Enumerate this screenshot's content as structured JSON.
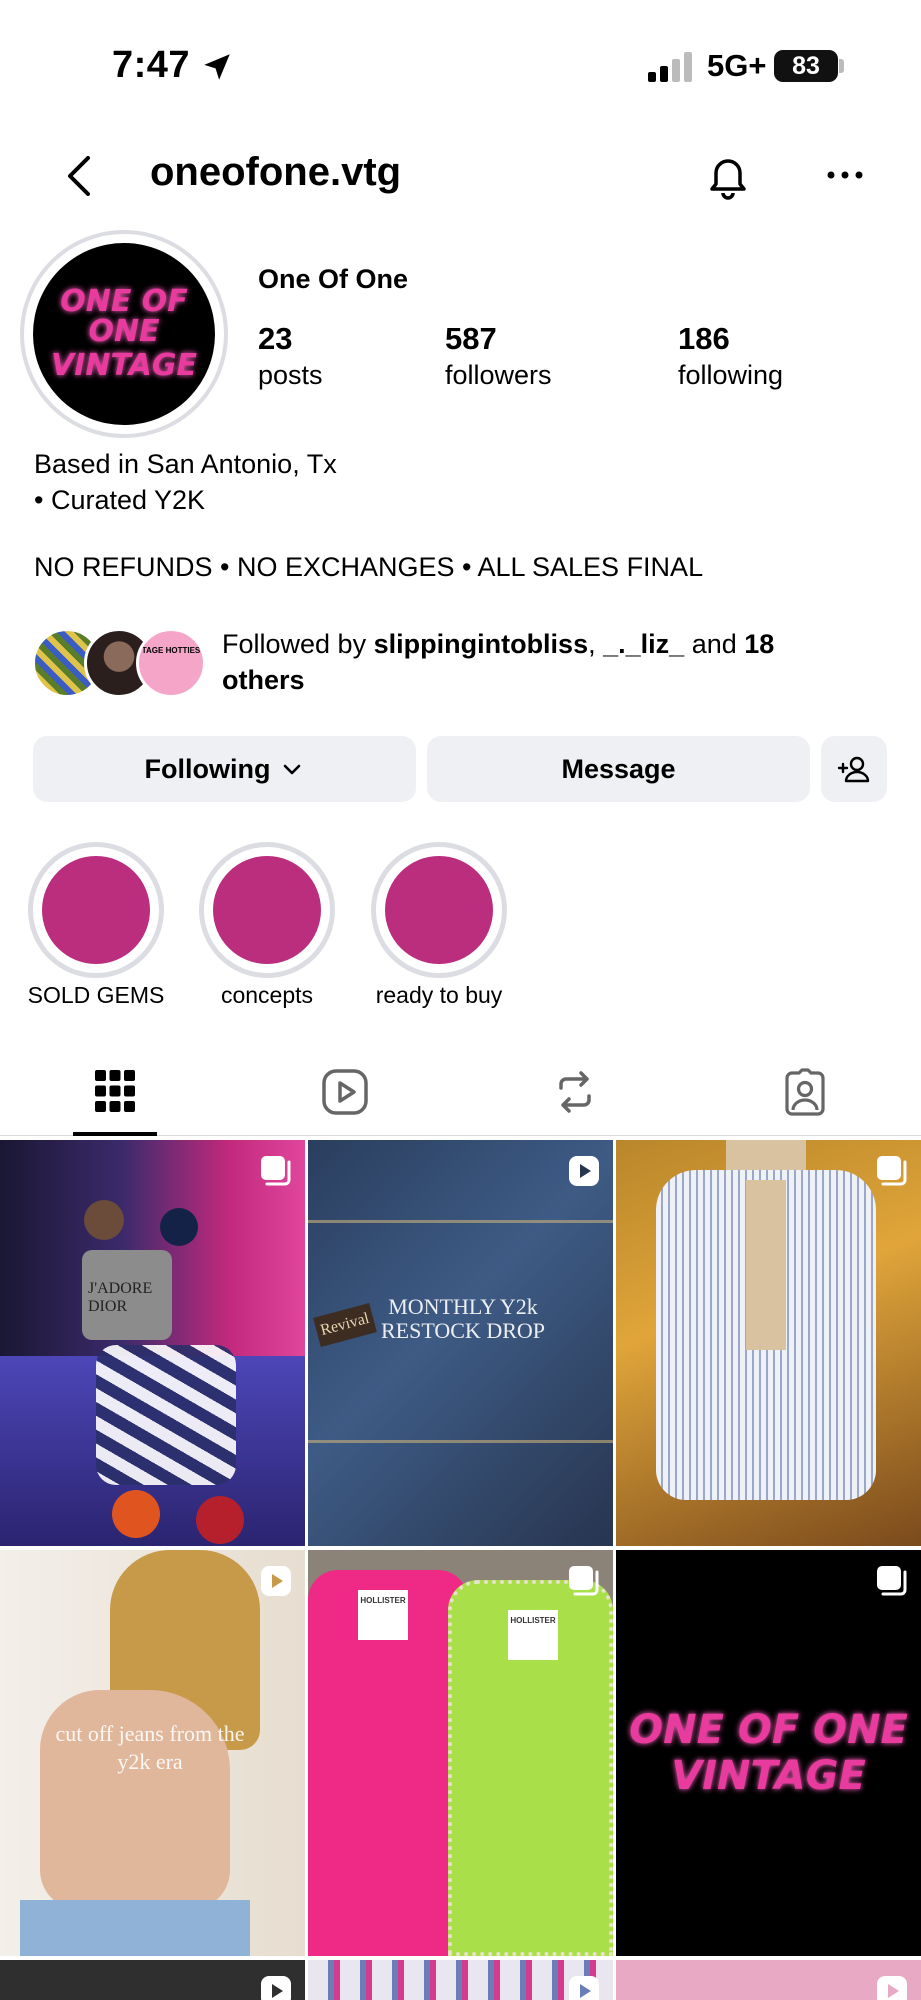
{
  "status_bar": {
    "time": "7:47",
    "network": "5G+",
    "battery": "83"
  },
  "header": {
    "username": "oneofone.vtg"
  },
  "profile": {
    "logo_line1": "ONE OF ONE",
    "logo_line2": "VINTAGE",
    "display_name": "One Of One",
    "stats": [
      {
        "value": "23",
        "label": "posts"
      },
      {
        "value": "587",
        "label": "followers"
      },
      {
        "value": "186",
        "label": "following"
      }
    ],
    "bio_line1": "Based in San Antonio, Tx",
    "bio_line2": "• Curated Y2K",
    "bio_policy": "NO REFUNDS • NO EXCHANGES • ALL SALES FINAL"
  },
  "followed_by": {
    "prefix": "Followed by",
    "user1": "slippingintobliss",
    "sep": ",",
    "user2": "_._liz_",
    "and": "and",
    "count": "18",
    "suffix": "others",
    "avatar3_text": "TAGE HOTTIES"
  },
  "actions": {
    "following": "Following",
    "message": "Message"
  },
  "highlights": [
    {
      "label": "SOLD GEMS"
    },
    {
      "label": "concepts"
    },
    {
      "label": "ready to buy"
    }
  ],
  "tabs": [
    "posts-grid",
    "reels",
    "reposts",
    "tagged"
  ],
  "posts": [
    {
      "overlay": "",
      "type": "carousel",
      "shirt_text": "J'ADORE DIOR"
    },
    {
      "overlay": "MONTHLY Y2k RESTOCK DROP",
      "type": "reel",
      "label_text": "Revival"
    },
    {
      "overlay": "",
      "type": "carousel"
    },
    {
      "overlay": "cut off jeans from the y2k era",
      "type": "reel"
    },
    {
      "overlay": "",
      "type": "carousel",
      "tag1": "HOLLISTER",
      "tag2": "HOLLISTER"
    },
    {
      "overlay": "",
      "type": "carousel",
      "logo_line1": "ONE OF ONE",
      "logo_line2": "VINTAGE"
    }
  ],
  "colors": {
    "highlight": "#bb2d7d",
    "brand_pink": "#e93a9d",
    "button_bg": "#eff0f3"
  }
}
